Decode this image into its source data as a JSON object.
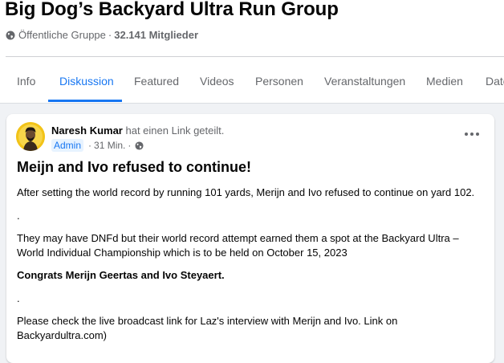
{
  "group": {
    "title": "Big Dog’s Backyard Ultra Run Group",
    "privacy": "Öffentliche Gruppe",
    "separator": "·",
    "members": "32.141 Mitglieder",
    "globe_icon": "globe-icon"
  },
  "tabs": [
    {
      "label": "Info",
      "active": false
    },
    {
      "label": "Diskussion",
      "active": true
    },
    {
      "label": "Featured",
      "active": false
    },
    {
      "label": "Videos",
      "active": false
    },
    {
      "label": "Personen",
      "active": false
    },
    {
      "label": "Veranstaltungen",
      "active": false
    },
    {
      "label": "Medien",
      "active": false
    },
    {
      "label": "Date",
      "active": false
    }
  ],
  "post": {
    "author": "Naresh Kumar",
    "action": "hat einen Link geteilt.",
    "badge": "Admin",
    "separator": "·",
    "time": "31 Min.",
    "more_icon": "more-horizontal-icon",
    "title": "Meijn and Ivo refused to continue!",
    "paragraphs": [
      {
        "text": "After setting the world record by running 101 yards, Merijn and Ivo refused to continue on yard 102.",
        "bold": false
      },
      {
        "text": ".",
        "bold": false
      },
      {
        "text": "They may have DNFd but their world record attempt earned them a spot at the Backyard Ultra – World Individual Championship which is to be held on October 15, 2023",
        "bold": false
      },
      {
        "text": "Congrats Merijn Geertas and Ivo Steyaert.",
        "bold": true
      },
      {
        "text": ".",
        "bold": false
      },
      {
        "text": "Please check the live broadcast link for Laz's interview with Merijn and Ivo. Link on Backyardultra.com)",
        "bold": false
      }
    ]
  },
  "colors": {
    "accent": "#1877f2",
    "secondary_text": "#65676b",
    "background": "#f0f2f5"
  }
}
